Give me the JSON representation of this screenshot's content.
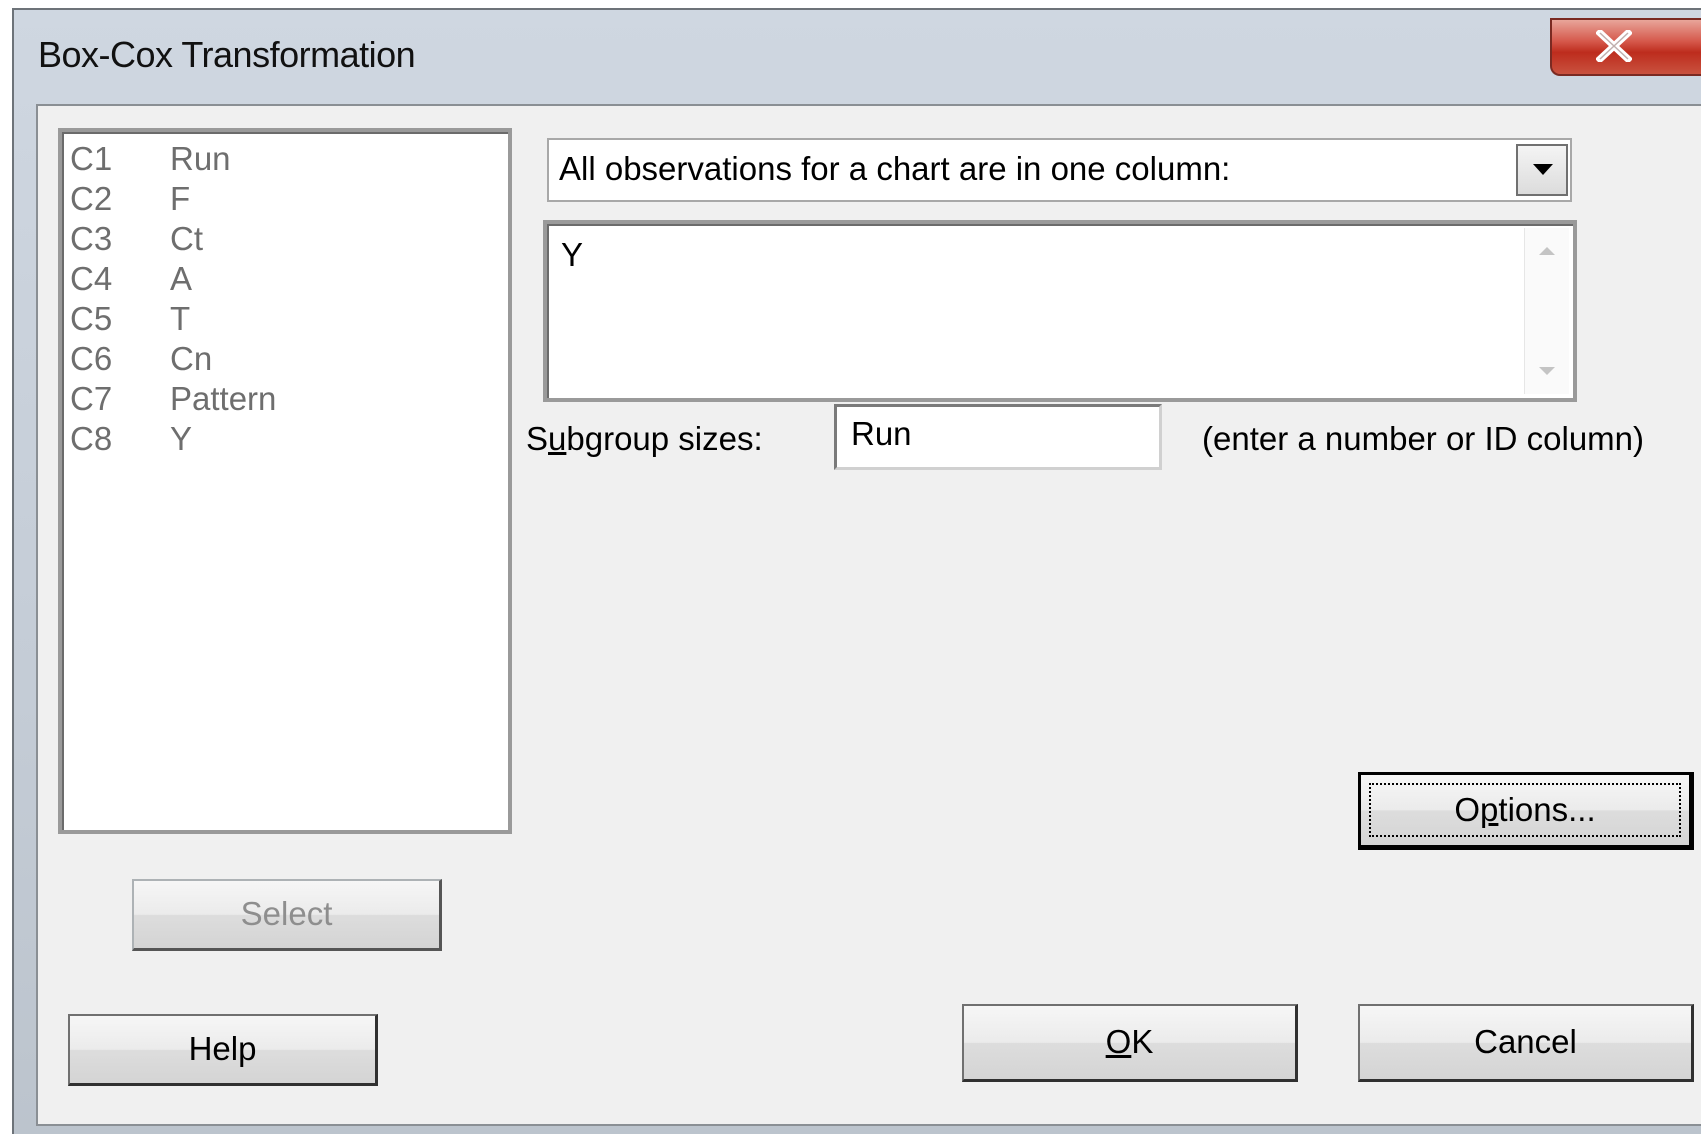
{
  "window": {
    "title": "Box-Cox Transformation"
  },
  "variables": [
    {
      "id": "C1",
      "name": "Run"
    },
    {
      "id": "C2",
      "name": "F"
    },
    {
      "id": "C3",
      "name": "Ct"
    },
    {
      "id": "C4",
      "name": "A"
    },
    {
      "id": "C5",
      "name": "T"
    },
    {
      "id": "C6",
      "name": "Cn"
    },
    {
      "id": "C7",
      "name": "Pattern"
    },
    {
      "id": "C8",
      "name": "Y"
    }
  ],
  "data_arrangement": {
    "selected": "All observations for a chart are in one column:"
  },
  "selected_variables": "Y",
  "subgroup": {
    "label_pre": "S",
    "label_mnemonic": "u",
    "label_post": "bgroup sizes:",
    "value": "Run",
    "hint": "(enter a number or ID column)"
  },
  "buttons": {
    "select": "Select",
    "options_pre": "O",
    "options_mnemonic": "p",
    "options_post": "tions...",
    "help": "Help",
    "ok_mnemonic": "O",
    "ok_post": "K",
    "cancel": "Cancel"
  }
}
